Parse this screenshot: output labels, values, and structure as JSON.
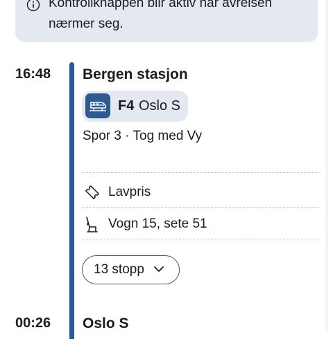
{
  "notice": {
    "text": "Kontrollknappen blir aktiv når avreisen nærmer seg."
  },
  "departure": {
    "time": "16:48",
    "station": "Bergen stasjon",
    "line_code": "F4",
    "line_destination": "Oslo S",
    "track_info": "Spor 3 · Tog med Vy"
  },
  "ticket": {
    "fare_label": "Lavpris",
    "seat_label": "Vogn 15, sete 51"
  },
  "stops_button": {
    "label": "13 stopp"
  },
  "arrival": {
    "time": "00:26",
    "station": "Oslo S"
  },
  "colors": {
    "accent": "#2e5a91",
    "chip_bg": "#e3e8f1"
  }
}
